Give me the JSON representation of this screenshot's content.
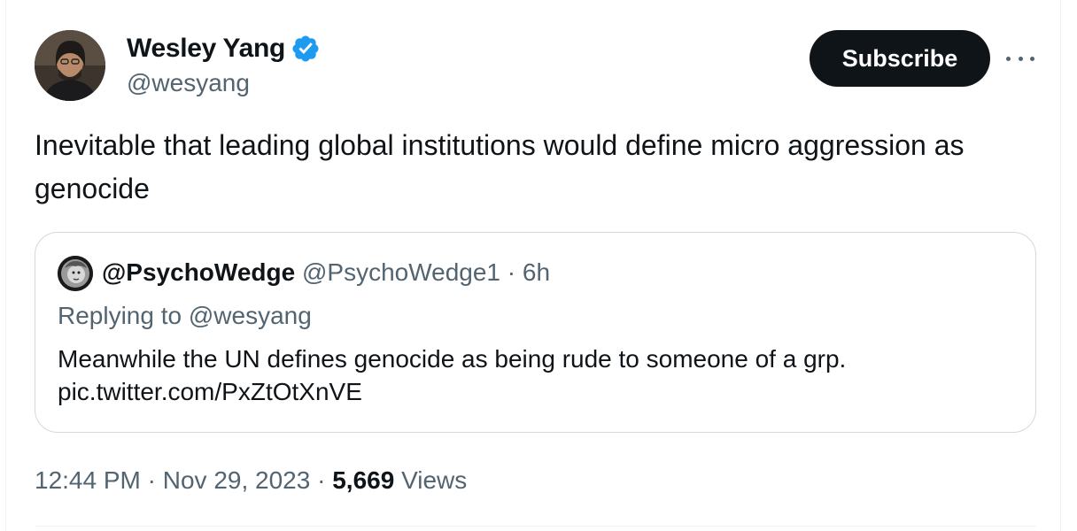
{
  "author": {
    "name": "Wesley Yang",
    "handle": "@wesyang",
    "verified": true,
    "avatar_icon": "user-avatar-photo"
  },
  "actions": {
    "subscribe_label": "Subscribe",
    "more_icon": "more-horizontal-icon"
  },
  "tweet": {
    "text": "Inevitable that leading global institutions would define micro aggression as genocide"
  },
  "quote": {
    "name": "@PsychoWedge",
    "handle": "@PsychoWedge1",
    "separator": "·",
    "time": "6h",
    "replying_prefix": "Replying to ",
    "replying_to": "@wesyang",
    "text_line1": "Meanwhile the UN defines genocide as being rude to someone of a grp.",
    "text_line2": "pic.twitter.com/PxZtOtXnVE"
  },
  "meta": {
    "time": "12:44 PM",
    "separator1": " · ",
    "date": "Nov 29, 2023",
    "separator2": " · ",
    "views_count": "5,669",
    "views_label": " Views"
  },
  "colors": {
    "text_primary": "#0f1419",
    "text_secondary": "#536471",
    "verified_blue": "#1d9bf0",
    "border": "#cfd9de"
  }
}
